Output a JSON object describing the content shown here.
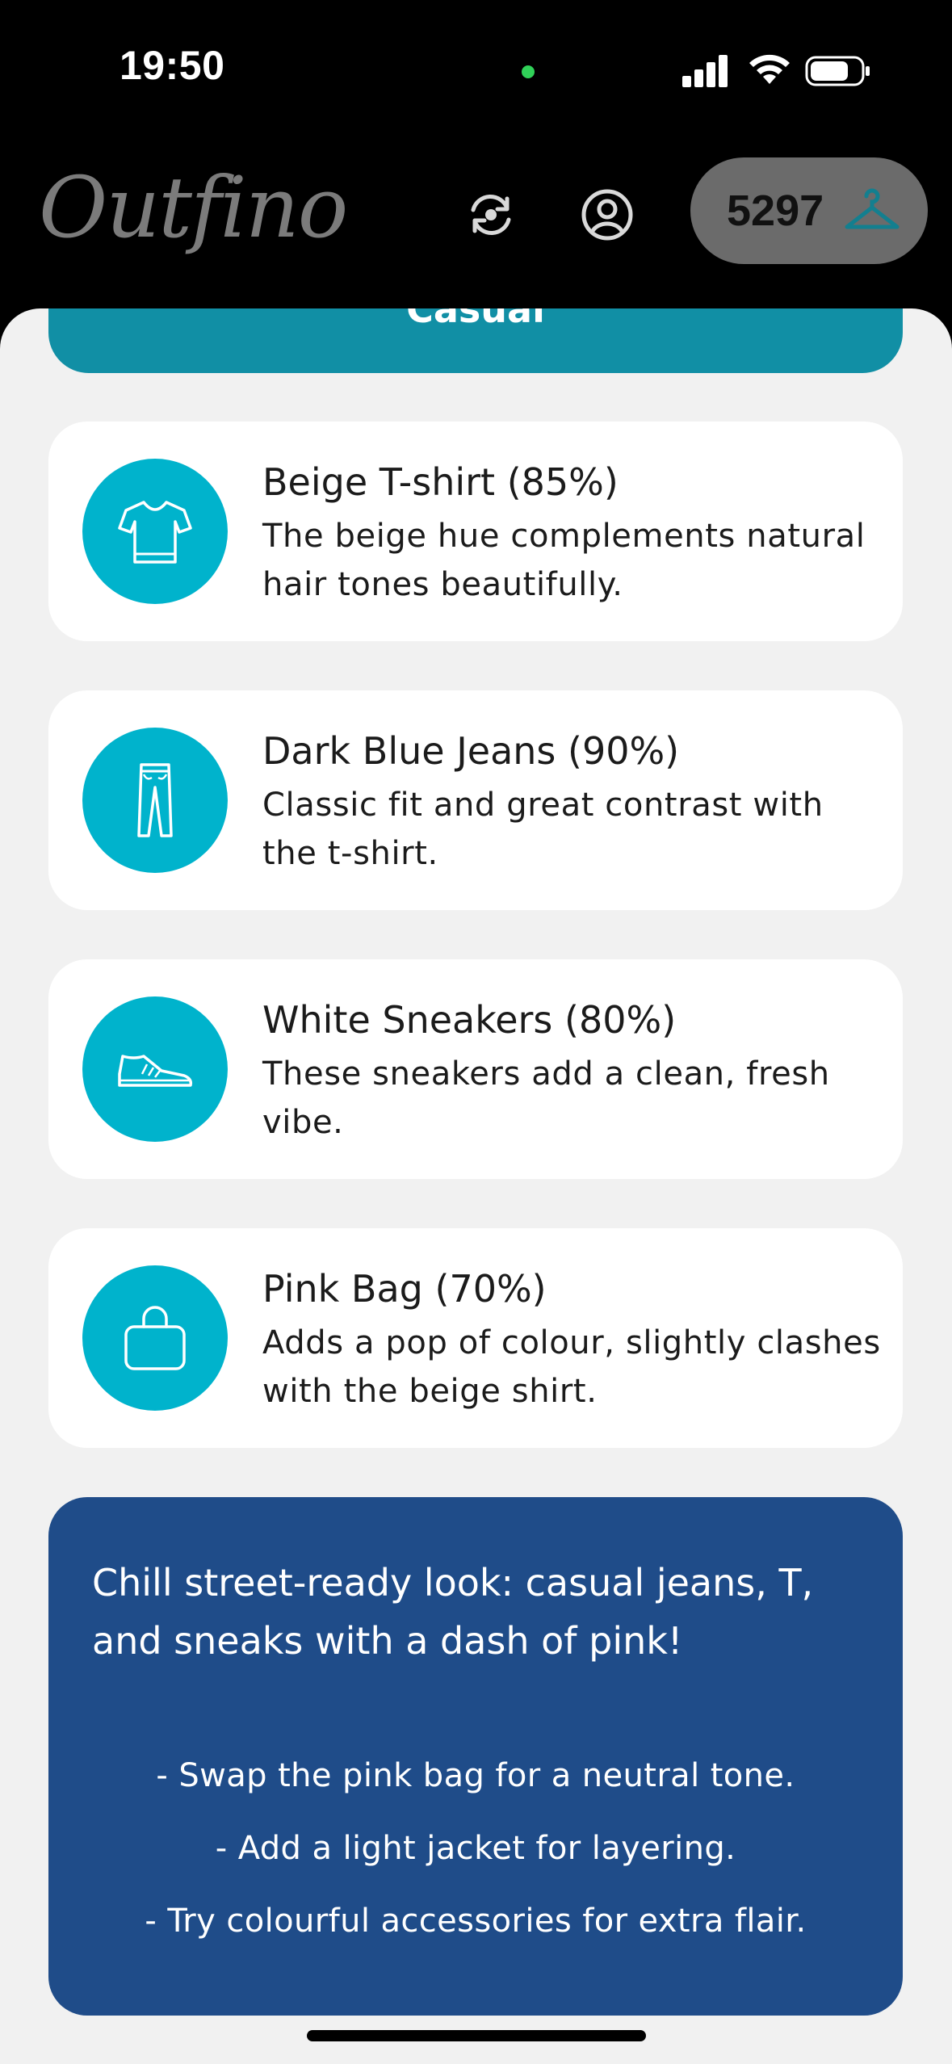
{
  "status_bar": {
    "time": "19:50"
  },
  "header": {
    "logo": "Outfino",
    "coins": "5297"
  },
  "style_tab": {
    "label": "Casual"
  },
  "items": [
    {
      "title": "Beige T-shirt (85%)",
      "description": "The beige hue complements natural hair tones beautifully.",
      "icon": "tshirt-icon"
    },
    {
      "title": "Dark Blue Jeans (90%)",
      "description": "Classic fit and great contrast with the t-shirt.",
      "icon": "jeans-icon"
    },
    {
      "title": "White Sneakers (80%)",
      "description": "These sneakers add a clean, fresh vibe.",
      "icon": "sneaker-icon"
    },
    {
      "title": "Pink Bag (70%)",
      "description": "Adds a pop of colour, slightly clashes with the beige shirt.",
      "icon": "bag-icon"
    }
  ],
  "summary": {
    "headline": "Chill street-ready look: casual jeans, T, and sneaks with a dash of pink!",
    "tips": [
      "- Swap the pink bag for a neutral tone.",
      "- Add a light jacket for layering.",
      "- Try colourful accessories for extra flair."
    ]
  },
  "colors": {
    "accent": "#00b3cc",
    "tab": "#118fa5",
    "summary_bg": "#1f4c89",
    "page_bg": "#f1f1f1"
  }
}
